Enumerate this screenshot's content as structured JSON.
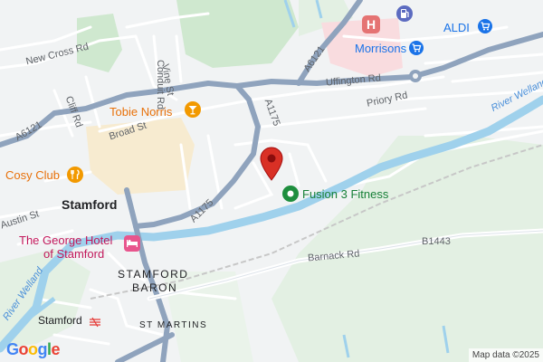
{
  "map": {
    "attribution": "Map data ©2025",
    "logo": {
      "letters": [
        "G",
        "o",
        "o",
        "g",
        "l",
        "e"
      ],
      "colors": [
        "#4285F4",
        "#EA4335",
        "#FBBC05",
        "#4285F4",
        "#34A853",
        "#EA4335"
      ]
    },
    "colors": {
      "land": "#f1f3f4",
      "park": "#cfe8cf",
      "green_area": "#e3f0e3",
      "water": "#9fd1ec",
      "major_road": "#8fa3bd",
      "minor_road": "#ffffff",
      "town_centre": "#f7ebd0",
      "hospital_area": "#f9dcdf",
      "pin": "#d93025"
    },
    "roads": {
      "new_cross_rd": "New Cross Rd",
      "conduit_rd": "Conduit Rd",
      "vine_st": "Vine St",
      "cliff_rd": "Cliff Rd",
      "a6121_west": "A6121",
      "a6121_north": "A6121",
      "uffington_rd": "Uffington Rd",
      "priory_rd": "Priory Rd",
      "broad_st": "Broad St",
      "a1175_north": "A1175",
      "a1175_south": "A1175",
      "austin_st": "Austin St",
      "barnack_rd": "Barnack Rd",
      "b1443": "B1443"
    },
    "places": {
      "stamford": "Stamford",
      "stamford_baron_1": "STAMFORD",
      "stamford_baron_2": "BARON",
      "st_martins": "ST MARTINS"
    },
    "pois": {
      "tobie_norris": "Tobie Norris",
      "cosy_club": "Cosy Club",
      "george_hotel_1": "The George Hotel",
      "george_hotel_2": "of Stamford",
      "morrisons": "Morrisons",
      "aldi": "ALDI",
      "fusion_fitness": "Fusion 3 Fitness",
      "station": "Stamford"
    },
    "water": {
      "river_welland_east": "River Welland",
      "river_welland_west": "River Welland"
    },
    "icons": {
      "bar": "cocktail-icon",
      "restaurant": "cutlery-icon",
      "hotel": "bed-icon",
      "hospital": "hospital-icon",
      "fuel": "fuel-icon",
      "shop": "shopping-cart-icon",
      "fitness": "fitness-icon",
      "rail": "rail-icon",
      "pin": "location-pin-icon"
    }
  }
}
